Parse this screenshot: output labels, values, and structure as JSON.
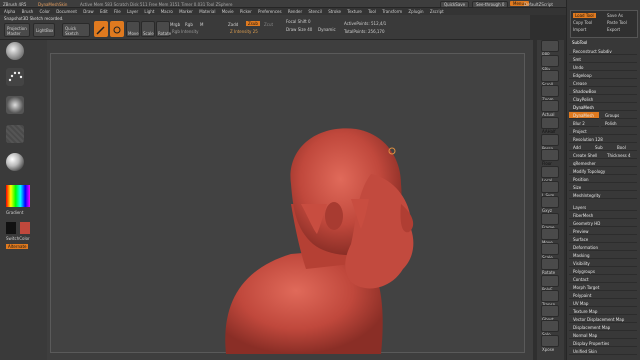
{
  "titlebar": {
    "app": "ZBrush 4R5",
    "doc": "DynaMeshSkin",
    "stats": "Active Mem 583  Scratch Disk 511  Free Mem 3151  Timer 0.031  Tool ZSphere",
    "quicksave": "QuickSave",
    "seethrough": "See-through 0",
    "menus_label": "Menus",
    "default_zscript": "DefaultZScript"
  },
  "menubar": {
    "items": [
      "Alpha",
      "Brush",
      "Color",
      "Document",
      "Draw",
      "Edit",
      "File",
      "Layer",
      "Light",
      "Macro",
      "Marker",
      "Material",
      "Movie",
      "Picker",
      "Preferences",
      "Render",
      "Stencil",
      "Stroke",
      "Texture",
      "Tool",
      "Transform",
      "Zplugin",
      "Zscript"
    ]
  },
  "toolbar": {
    "note": "Snapshot3D Sketch recorded.",
    "projection_master": "Projection Master",
    "lightbox": "LightBox",
    "quick_sketch": "Quick Sketch",
    "edit": "Edit",
    "draw": "Draw",
    "move": "Move",
    "scale": "Scale",
    "rotate": "Rotate",
    "mrgb": "Mrgb",
    "rgb": "Rgb",
    "m": "M",
    "rgb_intensity": "Rgb Intensity",
    "zadd": "Zadd",
    "zsub": "Zsub",
    "zcut": "Zcut",
    "z_intensity": "Z Intensity 25",
    "focal_shift": "Focal Shift 0",
    "draw_size": "Draw Size 40",
    "dynamic": "Dynamic",
    "active_points": "ActivePoints: 512,4/1",
    "total_points": "TotalPoints: 256,170"
  },
  "leftshelf": {
    "gradient": "Gradient",
    "switchcolor": "SwitchColor",
    "alternate": "Alternate"
  },
  "trays": {
    "tool_buttons": [
      "Load Tool",
      "Save As",
      "Copy Tool",
      "Paste Tool",
      "Import",
      "Export",
      "Clone",
      "Make PolyMesh3D",
      "GoZ",
      "All",
      "Visible",
      "R"
    ],
    "subtool": "SubTool",
    "items": [
      "Reconstruct Subdiv",
      "Smt",
      "Undo",
      "Smt",
      "Edgeloop",
      "Crease",
      "ShadowBox",
      "ClayPolish",
      "DynaMesh",
      "DynaMesh",
      "Groups",
      "Polish",
      "Blur 2",
      "Project",
      "Resolution 128",
      "Add",
      "Sub",
      "Bool",
      "Create Shell",
      "Thickness 4",
      "qRemesher",
      "Modify Topology",
      "Position",
      "Size",
      "MeshIntegrity"
    ],
    "menu_list": [
      "Layers",
      "FiberMesh",
      "Geometry HD",
      "Preview",
      "Surface",
      "Deformation",
      "Masking",
      "Visibility",
      "Polygroups",
      "Contact",
      "Morph Target",
      "Polypaint",
      "UV Map",
      "Texture Map",
      "Vector Displacement Map",
      "Displacement Map",
      "Normal Map",
      "Display Properties",
      "Unified Skin",
      "Import",
      "Export"
    ]
  },
  "rightshelf": {
    "labels": [
      "BPR",
      "SPix",
      "Scroll",
      "Zoom",
      "Actual",
      "AAHalf",
      "Persp",
      "Floor",
      "Local",
      "L.Sym",
      "Gxyz",
      "Frame",
      "Move",
      "Scale",
      "Rotate",
      "PolyF",
      "Transp",
      "Ghost",
      "Solo",
      "Xpose"
    ]
  },
  "colors": {
    "accent": "#e07a1f",
    "model": "#c0483c",
    "canvas": "#424242"
  }
}
